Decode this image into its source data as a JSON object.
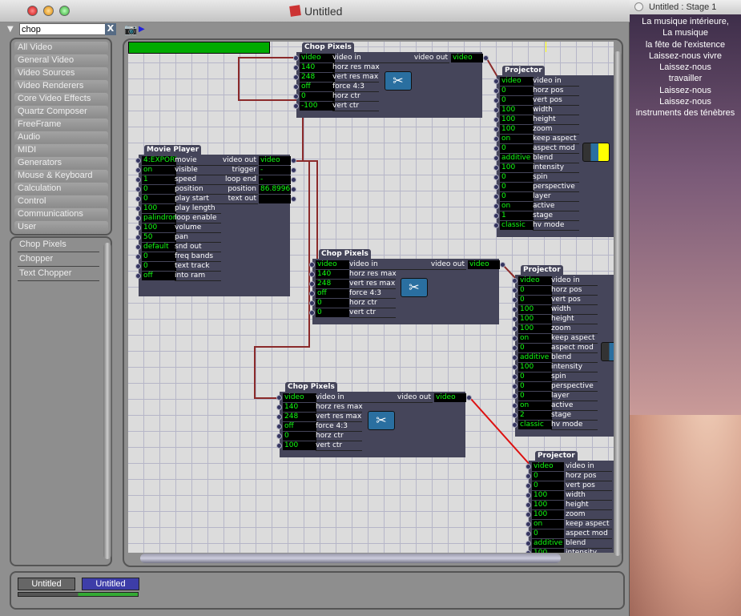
{
  "window": {
    "title": "Untitled",
    "search_value": "chop",
    "search_clear": "X"
  },
  "categories": [
    "All Video",
    "General Video",
    "Video Sources",
    "Video Renderers",
    "Core Video Effects",
    "Quartz Composer",
    "FreeFrame",
    "Audio",
    "MIDI",
    "Generators",
    "Mouse & Keyboard",
    "Calculation",
    "Control",
    "Communications",
    "User"
  ],
  "results": [
    "Chop Pixels",
    "Chopper",
    "Text Chopper"
  ],
  "actors": [
    {
      "title": "Chop Pixels",
      "inputs": [
        [
          "video",
          "video in"
        ],
        [
          "140",
          "horz res max"
        ],
        [
          "248",
          "vert res max"
        ],
        [
          "off",
          "force 4:3"
        ],
        [
          "0",
          "horz ctr"
        ],
        [
          "-100",
          "vert ctr"
        ]
      ],
      "outputs": [
        [
          "video out",
          "video"
        ]
      ]
    },
    {
      "title": "Projector",
      "inputs": [
        [
          "video",
          "video in"
        ],
        [
          "0",
          "horz pos"
        ],
        [
          "0",
          "vert pos"
        ],
        [
          "100",
          "width"
        ],
        [
          "100",
          "height"
        ],
        [
          "100",
          "zoom"
        ],
        [
          "on",
          "keep aspect"
        ],
        [
          "0",
          "aspect mod"
        ],
        [
          "additive",
          "blend"
        ],
        [
          "100",
          "intensity"
        ],
        [
          "0",
          "spin"
        ],
        [
          "0",
          "perspective"
        ],
        [
          "0",
          "layer"
        ],
        [
          "on",
          "active"
        ],
        [
          "1",
          "stage"
        ],
        [
          "classic",
          "hv mode"
        ]
      ],
      "outputs": []
    },
    {
      "title": "Movie Player",
      "inputs": [
        [
          "4:EXPORT",
          "movie"
        ],
        [
          "on",
          "visible"
        ],
        [
          "1",
          "speed"
        ],
        [
          "0",
          "position"
        ],
        [
          "0",
          "play start"
        ],
        [
          "100",
          "play length"
        ],
        [
          "palindrome",
          "loop enable"
        ],
        [
          "100",
          "volume"
        ],
        [
          "50",
          "pan"
        ],
        [
          "default",
          "snd out"
        ],
        [
          "0",
          "freq bands"
        ],
        [
          "0",
          "text track"
        ],
        [
          "off",
          "into ram"
        ]
      ],
      "outputs": [
        [
          "video out",
          "video"
        ],
        [
          "trigger",
          "-"
        ],
        [
          "loop end",
          "-"
        ],
        [
          "position",
          "86.8996"
        ],
        [
          "text out",
          ""
        ]
      ],
      "progress": 0.86
    },
    {
      "title": "Chop Pixels",
      "inputs": [
        [
          "video",
          "video in"
        ],
        [
          "140",
          "horz res max"
        ],
        [
          "248",
          "vert res max"
        ],
        [
          "off",
          "force 4:3"
        ],
        [
          "0",
          "horz ctr"
        ],
        [
          "0",
          "vert ctr"
        ]
      ],
      "outputs": [
        [
          "video out",
          "video"
        ]
      ]
    },
    {
      "title": "Projector",
      "inputs": [
        [
          "video",
          "video in"
        ],
        [
          "0",
          "horz pos"
        ],
        [
          "0",
          "vert pos"
        ],
        [
          "100",
          "width"
        ],
        [
          "100",
          "height"
        ],
        [
          "100",
          "zoom"
        ],
        [
          "on",
          "keep aspect"
        ],
        [
          "0",
          "aspect mod"
        ],
        [
          "additive",
          "blend"
        ],
        [
          "100",
          "intensity"
        ],
        [
          "0",
          "spin"
        ],
        [
          "0",
          "perspective"
        ],
        [
          "0",
          "layer"
        ],
        [
          "on",
          "active"
        ],
        [
          "2",
          "stage"
        ],
        [
          "classic",
          "hv mode"
        ]
      ],
      "outputs": []
    },
    {
      "title": "Chop Pixels",
      "inputs": [
        [
          "video",
          "video in"
        ],
        [
          "140",
          "horz res max"
        ],
        [
          "248",
          "vert res max"
        ],
        [
          "off",
          "force 4:3"
        ],
        [
          "0",
          "horz ctr"
        ],
        [
          "100",
          "vert ctr"
        ]
      ],
      "outputs": [
        [
          "video out",
          "video"
        ]
      ]
    },
    {
      "title": "Projector",
      "inputs": [
        [
          "video",
          "video in"
        ],
        [
          "0",
          "horz pos"
        ],
        [
          "0",
          "vert pos"
        ],
        [
          "100",
          "width"
        ],
        [
          "100",
          "height"
        ],
        [
          "100",
          "zoom"
        ],
        [
          "on",
          "keep aspect"
        ],
        [
          "0",
          "aspect mod"
        ],
        [
          "additive",
          "blend"
        ],
        [
          "100",
          "intensity"
        ]
      ],
      "outputs": []
    }
  ],
  "scene_tabs": [
    {
      "label": "Untitled",
      "active": false
    },
    {
      "label": "Untitled",
      "active": true
    }
  ],
  "stage": {
    "title": "Untitled : Stage 1",
    "lines": [
      "La musique intérieure,",
      "La musique",
      "la fête de l'existence",
      "Laissez-nous vivre",
      "Laissez-nous",
      "travailler",
      "Laissez-nous",
      "Laissez-nous",
      "instruments des ténèbres"
    ]
  },
  "colors": {
    "value_text": "#22ff22",
    "wire": "#8b2a2a",
    "wire_active": "#dd1111",
    "actor_bg": "#45455a",
    "active_tab": "#3d3da8"
  }
}
